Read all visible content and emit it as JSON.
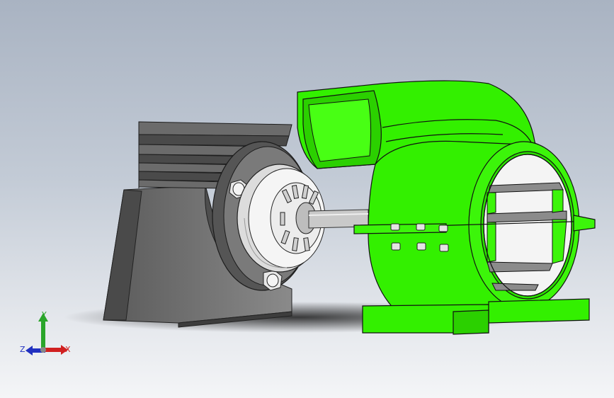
{
  "triad": {
    "x_label": "X",
    "y_label": "Y",
    "z_label": "Z"
  },
  "colors": {
    "background_top": "#a9b3c2",
    "background_bottom": "#f4f5f7",
    "housing_green": "#33f000",
    "motor_gray": "#6f6f6f",
    "axis_x": "#d02020",
    "axis_y": "#2aa52a",
    "axis_z": "#2030c0"
  },
  "model": {
    "parts": [
      "motor-body",
      "motor-cooling-fins",
      "motor-flange",
      "bearing-cap",
      "shaft",
      "fan-housing",
      "outlet-duct",
      "housing-base",
      "flange-bolts"
    ]
  }
}
